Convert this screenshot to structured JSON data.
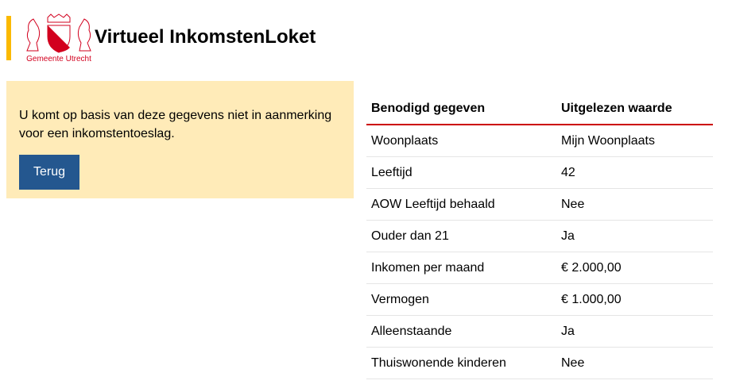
{
  "header": {
    "title": "Virtueel InkomstenLoket",
    "logo_text": "Gemeente Utrecht"
  },
  "notice": {
    "message": "U komt op basis van deze gegevens niet in aanmerking voor een inkomstentoeslag.",
    "back_label": "Terug"
  },
  "table": {
    "headers": [
      "Benodigd gegeven",
      "Uitgelezen waarde"
    ],
    "rows": [
      [
        "Woonplaats",
        "Mijn Woonplaats"
      ],
      [
        "Leeftijd",
        "42"
      ],
      [
        "AOW Leeftijd behaald",
        "Nee"
      ],
      [
        "Ouder dan 21",
        "Ja"
      ],
      [
        "Inkomen per maand",
        "€ 2.000,00"
      ],
      [
        "Vermogen",
        "€ 1.000,00"
      ],
      [
        "Alleenstaande",
        "Ja"
      ],
      [
        "Thuiswonende kinderen",
        "Nee"
      ]
    ]
  }
}
